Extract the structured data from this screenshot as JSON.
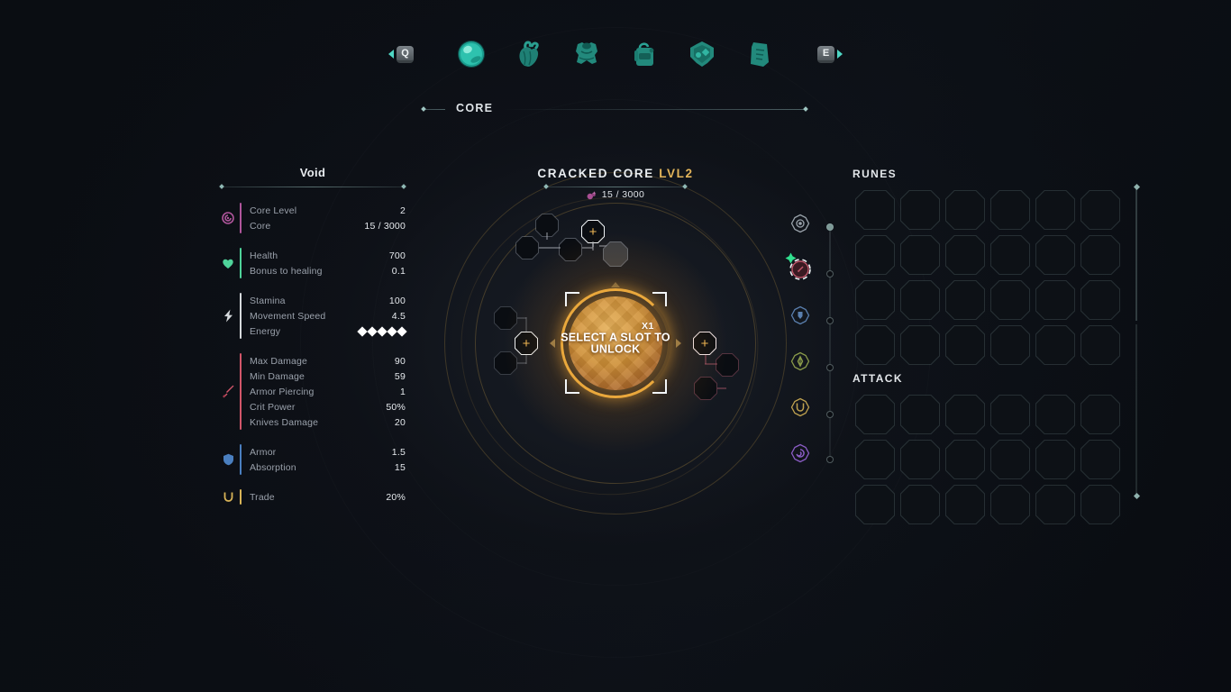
{
  "nav": {
    "prev_key": "Q",
    "next_key": "E",
    "active_label": "CORE",
    "tabs": [
      {
        "id": "core",
        "icon": "core-orb-icon",
        "active": true
      },
      {
        "id": "heart",
        "icon": "heart-organ-icon",
        "active": false
      },
      {
        "id": "armor",
        "icon": "chest-armor-icon",
        "active": false
      },
      {
        "id": "backpack",
        "icon": "backpack-icon",
        "active": false
      },
      {
        "id": "gear",
        "icon": "gear-shield-icon",
        "active": false
      },
      {
        "id": "scroll",
        "icon": "scroll-tablet-icon",
        "active": false
      }
    ]
  },
  "stats": {
    "title": "Void",
    "groups": [
      {
        "icon": "core-spiral-icon",
        "accent": "#b0569c",
        "rows": [
          {
            "name": "Core Level",
            "value": "2"
          },
          {
            "name": "Core",
            "value": "15 / 3000"
          }
        ]
      },
      {
        "icon": "heart-icon",
        "accent": "#4fd39a",
        "rows": [
          {
            "name": "Health",
            "value": "700"
          },
          {
            "name": "Bonus to healing",
            "value": "0.1"
          }
        ]
      },
      {
        "icon": "lightning-bolt-icon",
        "accent": "#d6dadd",
        "rows": [
          {
            "name": "Stamina",
            "value": "100"
          },
          {
            "name": "Movement Speed",
            "value": "4.5"
          },
          {
            "name": "Energy",
            "value": "",
            "diamonds": 5
          }
        ]
      },
      {
        "icon": "sword-icon",
        "accent": "#d2566a",
        "rows": [
          {
            "name": "Max Damage",
            "value": "90"
          },
          {
            "name": "Min Damage",
            "value": "59"
          },
          {
            "name": "Armor Piercing",
            "value": "1"
          },
          {
            "name": "Crit Power",
            "value": "50%"
          },
          {
            "name": "Knives Damage",
            "value": "20"
          }
        ]
      },
      {
        "icon": "shield-icon",
        "accent": "#4a7fc0",
        "rows": [
          {
            "name": "Armor",
            "value": "1.5"
          },
          {
            "name": "Absorption",
            "value": "15"
          }
        ]
      },
      {
        "icon": "horseshoe-icon",
        "accent": "#d9b457",
        "rows": [
          {
            "name": "Trade",
            "value": "20%"
          }
        ]
      }
    ]
  },
  "core_panel": {
    "name": "CRACKED CORE",
    "level": "LVL2",
    "xp": "15 / 3000",
    "xp_icon": "void-shard-icon",
    "center_text": "SELECT A SLOT TO UNLOCK",
    "multiplier": "X1",
    "slot_add_label": "+"
  },
  "rail": {
    "items": [
      {
        "id": "general",
        "icon": "target-dot-icon",
        "color": "#9aa3ab",
        "selected": false
      },
      {
        "id": "attack",
        "icon": "sword-swirl-icon",
        "color": "#c0566a",
        "selected": true,
        "badge": "upgrade-arrow-icon"
      },
      {
        "id": "defense",
        "icon": "shield-rune-icon",
        "color": "#5a7fae",
        "selected": false
      },
      {
        "id": "nature",
        "icon": "leaf-rune-icon",
        "color": "#8a9b4a",
        "selected": false
      },
      {
        "id": "fortune",
        "icon": "horseshoe-rune-icon",
        "color": "#c0a24f",
        "selected": false
      },
      {
        "id": "arcane",
        "icon": "spiral-rune-icon",
        "color": "#8a5cc4",
        "selected": false
      }
    ]
  },
  "runes_panel": {
    "title": "RUNES",
    "columns": 6,
    "rows": 4,
    "filled_slots": []
  },
  "attack_panel": {
    "title": "ATTACK",
    "columns": 6,
    "rows": 3,
    "filled_slots": []
  },
  "colors": {
    "background": "#0a0d12",
    "accent_gold": "#e3b55a",
    "accent_teal": "#4fd6c4",
    "text_primary": "#e6eaee",
    "text_muted": "#9aa1ab"
  }
}
